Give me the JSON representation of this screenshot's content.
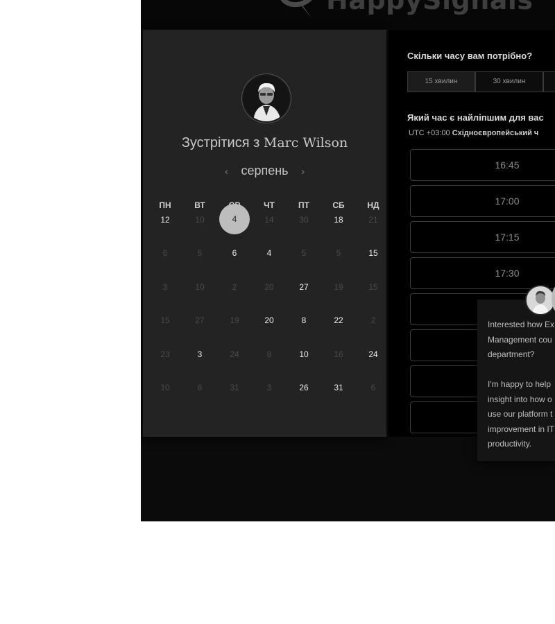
{
  "brand": {
    "name": "HappySignals"
  },
  "calendar": {
    "title_prefix": "Зустрітися з",
    "host_name": "Marc Wilson",
    "month": "серпень",
    "prev_glyph": "‹",
    "next_glyph": "›",
    "weekdays": [
      "ПН",
      "ВТ",
      "СР",
      "ЧТ",
      "ПТ",
      "СБ",
      "НД"
    ],
    "selected_day": "4",
    "weeks": [
      [
        {
          "d": "12",
          "on": true
        },
        {
          "d": "10",
          "on": false
        },
        {
          "d": "4",
          "on": true,
          "sel": true
        },
        {
          "d": "14",
          "on": false
        },
        {
          "d": "30",
          "on": false
        },
        {
          "d": "18",
          "on": true
        },
        {
          "d": "21",
          "on": false
        }
      ],
      [
        {
          "d": "6",
          "on": false
        },
        {
          "d": "5",
          "on": false
        },
        {
          "d": "6",
          "on": true
        },
        {
          "d": "4",
          "on": true
        },
        {
          "d": "5",
          "on": false
        },
        {
          "d": "5",
          "on": false
        },
        {
          "d": "15",
          "on": true
        }
      ],
      [
        {
          "d": "3",
          "on": false
        },
        {
          "d": "10",
          "on": false
        },
        {
          "d": "2",
          "on": false
        },
        {
          "d": "20",
          "on": false
        },
        {
          "d": "27",
          "on": true
        },
        {
          "d": "19",
          "on": false
        },
        {
          "d": "15",
          "on": false
        }
      ],
      [
        {
          "d": "15",
          "on": false
        },
        {
          "d": "27",
          "on": false
        },
        {
          "d": "19",
          "on": false
        },
        {
          "d": "20",
          "on": true
        },
        {
          "d": "8",
          "on": true
        },
        {
          "d": "22",
          "on": true
        },
        {
          "d": "2",
          "on": false
        }
      ],
      [
        {
          "d": "23",
          "on": false
        },
        {
          "d": "3",
          "on": true
        },
        {
          "d": "24",
          "on": false
        },
        {
          "d": "8",
          "on": false
        },
        {
          "d": "10",
          "on": true
        },
        {
          "d": "16",
          "on": false
        },
        {
          "d": "24",
          "on": true
        }
      ],
      [
        {
          "d": "10",
          "on": false
        },
        {
          "d": "8",
          "on": false
        },
        {
          "d": "31",
          "on": false
        },
        {
          "d": "3",
          "on": false
        },
        {
          "d": "26",
          "on": true
        },
        {
          "d": "31",
          "on": true
        },
        {
          "d": "6",
          "on": false
        }
      ]
    ]
  },
  "booking": {
    "duration_question": "Скільки часу вам потрібно?",
    "durations": [
      {
        "label": "15 хвилин",
        "active": true
      },
      {
        "label": "30 хвилин",
        "active": false
      },
      {
        "label": "",
        "active": false
      }
    ],
    "time_question": "Який час є найліпшим для вас",
    "timezone_offset": "UTC +03:00",
    "timezone_name": "Східноєвропейський ч",
    "slots": [
      "16:45",
      "17:00",
      "17:15",
      "17:30",
      "",
      "",
      "",
      ""
    ]
  },
  "chat": {
    "lines": [
      "Interested how Ex",
      "Management cou",
      "department?",
      "",
      "I'm happy to help",
      "insight into how o",
      "use our platform t",
      "improvement in IT",
      "productivity."
    ]
  }
}
